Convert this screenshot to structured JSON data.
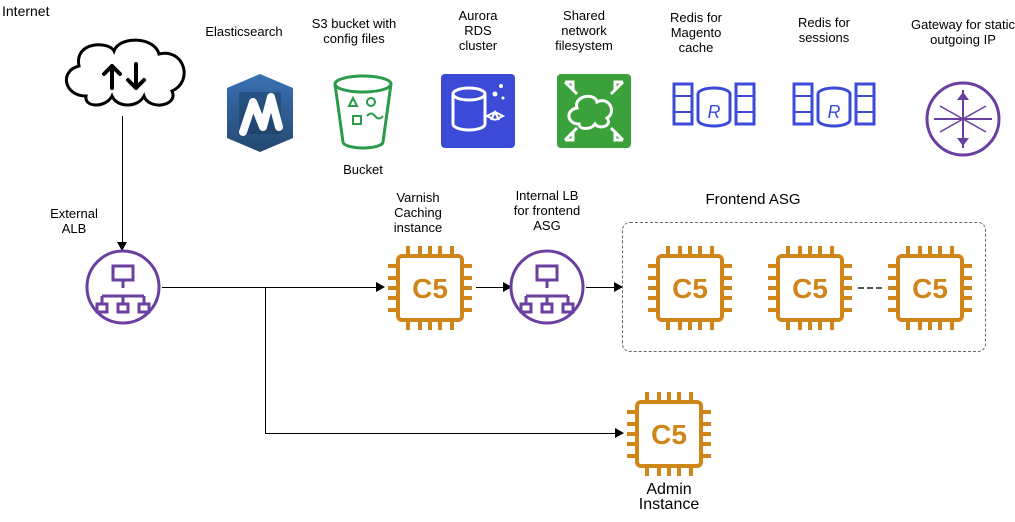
{
  "title": "Internet",
  "toprow": {
    "elasticsearch": "Elasticsearch",
    "s3": "S3 bucket with\nconfig files",
    "s3_below": "Bucket",
    "aurora": "Aurora\nRDS\ncluster",
    "sharedfs": "Shared\nnetwork\nfilesystem",
    "redis_magento": "Redis for\nMagento\ncache",
    "redis_sessions": "Redis for\nsessions",
    "gateway": "Gateway for static\noutgoing IP"
  },
  "flow": {
    "ext_alb": "External\nALB",
    "varnish": "Varnish\nCaching\ninstance",
    "ilb": "Internal LB\nfor frontend\nASG",
    "frontend_asg": "Frontend ASG",
    "admin_below": "Admin\nInstance",
    "c5_label": "C5",
    "redis_r": "R"
  }
}
